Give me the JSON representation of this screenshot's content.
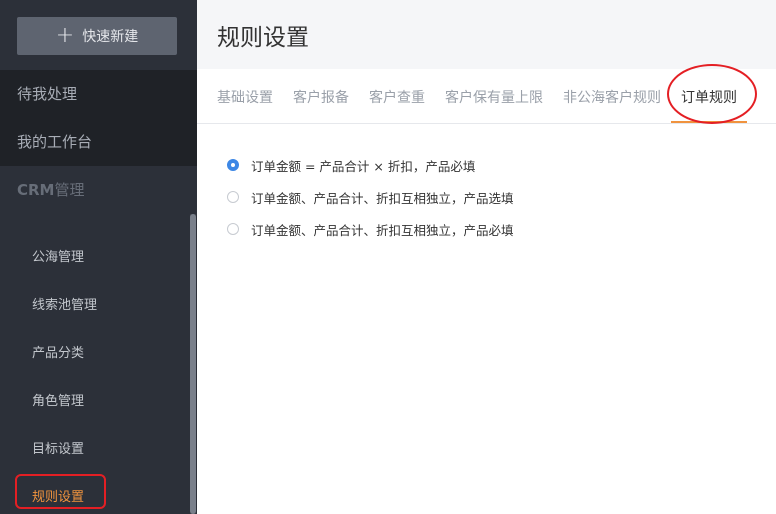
{
  "sidebar": {
    "new_button": {
      "icon": "plus-icon",
      "label": "快速新建"
    },
    "pending": "待我处理",
    "workbench": "我的工作台",
    "crm": {
      "bold": "CRM",
      "rest": "管理"
    },
    "items": [
      {
        "label": "公海管理",
        "active": false
      },
      {
        "label": "线索池管理",
        "active": false
      },
      {
        "label": "产品分类",
        "active": false
      },
      {
        "label": "角色管理",
        "active": false
      },
      {
        "label": "目标设置",
        "active": false
      },
      {
        "label": "规则设置",
        "active": true
      }
    ]
  },
  "main": {
    "title": "规则设置",
    "tabs": [
      {
        "label": "基础设置",
        "active": false
      },
      {
        "label": "客户报备",
        "active": false
      },
      {
        "label": "客户查重",
        "active": false
      },
      {
        "label": "客户保有量上限",
        "active": false
      },
      {
        "label": "非公海客户规则",
        "active": false
      },
      {
        "label": "订单规则",
        "active": true
      }
    ],
    "options": [
      {
        "label": "订单金额 = 产品合计 × 折扣，产品必填",
        "checked": true
      },
      {
        "label": "订单金额、产品合计、折扣互相独立，产品选填",
        "checked": false
      },
      {
        "label": "订单金额、产品合计、折扣互相独立，产品必填",
        "checked": false
      }
    ]
  },
  "colors": {
    "accent": "#f0933e",
    "radio_checked": "#3d87e5",
    "highlight": "#e41f24",
    "sidebar_bg": "#2c3039"
  }
}
